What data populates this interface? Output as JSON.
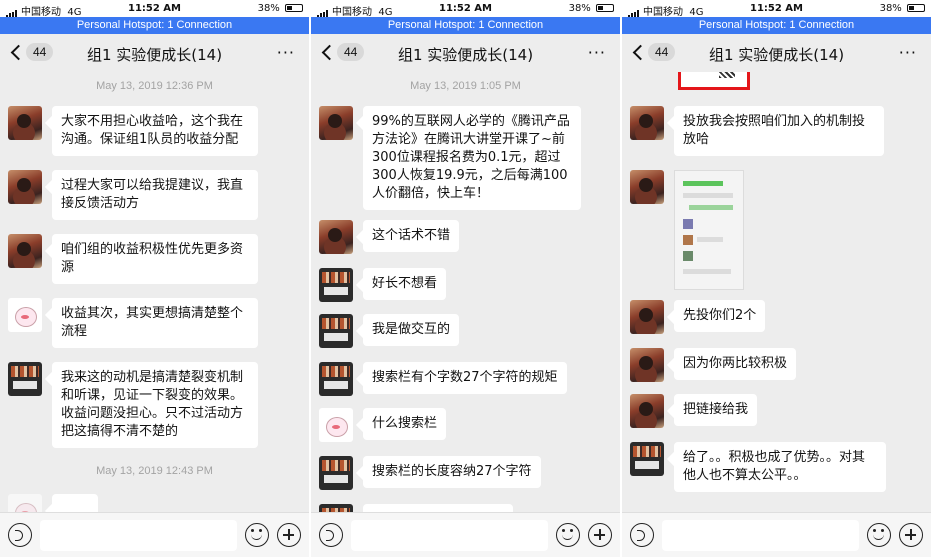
{
  "status_bar": {
    "carrier": "中国移动",
    "network": "4G",
    "time": "11:52 AM",
    "battery": "38%",
    "battery_level": 0.38
  },
  "hotspot_text": "Personal Hotspot: 1 Connection",
  "nav": {
    "back_count": "44",
    "title": "组1 实验便成长(14)",
    "more_label": "···"
  },
  "screens": [
    {
      "time_labels": [
        "May 13, 2019 12:36 PM",
        "May 13, 2019 12:43 PM"
      ],
      "messages": [
        {
          "avatar": "photo",
          "text": "大家不用担心收益哈，这个我在沟通。保证组1队员的收益分配"
        },
        {
          "avatar": "photo",
          "text": "过程大家可以给我提建议，我直接反馈活动方"
        },
        {
          "avatar": "photo",
          "text": "咱们组的收益积极性优先更多资源"
        },
        {
          "avatar": "cartoon",
          "text": "收益其次，其实更想搞清楚整个流程"
        },
        {
          "avatar": "group",
          "text": "我来这的动机是搞清楚裂变机制和听课，见证一下裂变的效果。收益问题没担心。只不过活动方把这搞得不清不楚的"
        }
      ]
    },
    {
      "time_labels": [
        "May 13, 2019 1:05 PM"
      ],
      "messages": [
        {
          "avatar": "photo",
          "text": "99%的互联网人必学的《腾讯产品方法论》在腾讯大讲堂开课了~前300位课程报名费为0.1元，超过300人恢复19.9元，之后每满100人价翻倍，快上车！"
        },
        {
          "avatar": "photo",
          "text": "这个话术不错"
        },
        {
          "avatar": "group",
          "text": "好长不想看"
        },
        {
          "avatar": "group",
          "text": "我是做交互的"
        },
        {
          "avatar": "group",
          "text": "搜索栏有个字数27个字符的规矩"
        },
        {
          "avatar": "cartoon",
          "text": "什么搜索栏"
        },
        {
          "avatar": "group",
          "text": "搜索栏的长度容纳27个字符"
        }
      ]
    },
    {
      "time_labels": [],
      "messages": [
        {
          "avatar": "photo",
          "text": "投放我会按照咱们加入的机制投放哈"
        },
        {
          "avatar": "photo",
          "text": "",
          "image": "chat-screenshot-thumbnail"
        },
        {
          "avatar": "photo",
          "text": "先投你们2个"
        },
        {
          "avatar": "photo",
          "text": "因为你两比较积极"
        },
        {
          "avatar": "photo",
          "text": "把链接给我"
        },
        {
          "avatar": "group",
          "text": "给了。。积极也成了优势。。对其他人也不算太公平。。"
        }
      ]
    }
  ]
}
